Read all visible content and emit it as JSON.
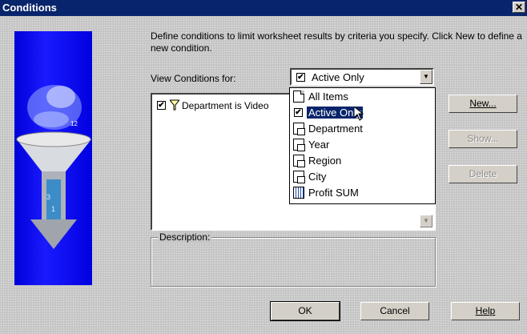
{
  "window": {
    "title": "Conditions",
    "close_glyph": "✕"
  },
  "intro_text": "Define conditions to limit worksheet results by criteria you specify. Click New to define a new condition.",
  "view_conditions": {
    "label": "View Conditions for:",
    "selected": "Active Only",
    "arrow_glyph": "▼"
  },
  "conditions_list": [
    {
      "label": "Department is Video",
      "checked": true,
      "icon": "funnel-icon"
    }
  ],
  "dropdown_options": [
    {
      "label": "All Items",
      "icon": "document-icon"
    },
    {
      "label": "Active Only",
      "icon": "checkbox-icon",
      "selected": true
    },
    {
      "label": "Department",
      "icon": "folder-item-icon"
    },
    {
      "label": "Year",
      "icon": "folder-item-icon"
    },
    {
      "label": "Region",
      "icon": "folder-item-icon"
    },
    {
      "label": "City",
      "icon": "folder-item-icon"
    },
    {
      "label": "Profit SUM",
      "icon": "measure-icon"
    }
  ],
  "side_buttons": {
    "new": "New...",
    "show": "Show...",
    "delete": "Delete"
  },
  "description": {
    "label": "Description:"
  },
  "bottom_buttons": {
    "ok": "OK",
    "cancel": "Cancel",
    "help": "Help"
  },
  "glyphs": {
    "check": "✔",
    "scroll_down": "▼"
  },
  "colors": {
    "titlebar": "#08246b",
    "selection": "#08246b",
    "illustration_blue": "#0000d8"
  }
}
